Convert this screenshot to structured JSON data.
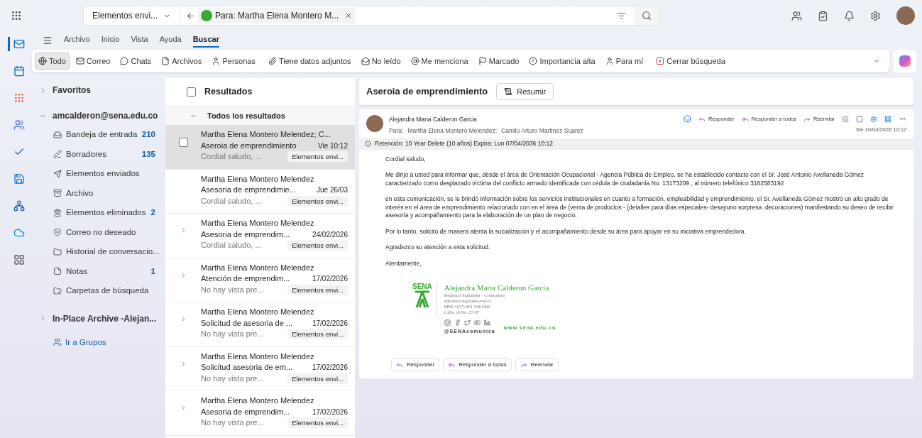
{
  "top_bar": {
    "folder_scope": "Elementos envi...",
    "search_chip": "Para: Martha Elena Montero M..."
  },
  "app_rail": [
    {
      "selected": true
    },
    {
      "selected": false
    },
    {
      "selected": false
    },
    {
      "selected": false
    },
    {
      "selected": false
    },
    {
      "selected": false
    },
    {
      "selected": false
    },
    {
      "selected": false
    },
    {
      "selected": false
    }
  ],
  "ribbon_tabs": [
    {
      "label": "Archivo",
      "selected": false
    },
    {
      "label": "Inicio",
      "selected": false
    },
    {
      "label": "Vista",
      "selected": false
    },
    {
      "label": "Ayuda",
      "selected": false
    },
    {
      "label": "Buscar",
      "selected": true
    }
  ],
  "filters": [
    {
      "label": "Todo",
      "selected": true
    },
    {
      "label": "Correo",
      "selected": false
    },
    {
      "label": "Chats",
      "selected": false
    },
    {
      "label": "Archivos",
      "selected": false
    },
    {
      "label": "Personas",
      "selected": false
    },
    {
      "label": "Tiene datos adjuntos",
      "selected": false
    },
    {
      "label": "No leído",
      "selected": false
    },
    {
      "label": "Me menciona",
      "selected": false
    },
    {
      "label": "Marcado",
      "selected": false
    },
    {
      "label": "Importancia alta",
      "selected": false
    },
    {
      "label": "Para mí",
      "selected": false
    },
    {
      "label": "Cerrar búsqueda",
      "selected": false
    }
  ],
  "folder_pane": {
    "favorites": "Favoritos",
    "account": "amcalderon@sena.edu.co",
    "folders": [
      {
        "name": "Bandeja de entrada",
        "count": "210"
      },
      {
        "name": "Borradores",
        "count": "135"
      },
      {
        "name": "Elementos enviados"
      },
      {
        "name": "Archivo"
      },
      {
        "name": "Elementos eliminados",
        "count": "2"
      },
      {
        "name": "Correo no deseado"
      },
      {
        "name": "Historial de conversacio..."
      },
      {
        "name": "Notas",
        "count": "1"
      },
      {
        "name": "Carpetas de búsqueda"
      }
    ],
    "archive": "In-Place Archive -Alejan...",
    "groups_link": "Ir a Grupos"
  },
  "message_list": {
    "title": "Resultados",
    "select_all_checked": false,
    "group": "Todos los resultados",
    "items": [
      {
        "sender": "Martha Elena Montero Melendez; C...",
        "subject": "Aseroia de emprendimiento",
        "date": "Vie 10:12",
        "preview": "Cordial saludo, ...",
        "folder": "Elementos envi...",
        "selected": true,
        "thread": false
      },
      {
        "sender": "Martha Elena Montero Melendez",
        "subject": "Asesoria de emprendimie...",
        "date": "Jue 26/03",
        "preview": "Cordial saludo, ...",
        "folder": "Elementos envi...",
        "selected": false,
        "thread": false
      },
      {
        "sender": "Martha Elena Montero Melendez",
        "subject": "Asesoria de emprendim...",
        "date": "24/02/2026",
        "preview": "Cordial saludo, ...",
        "folder": "Elementos envi...",
        "selected": false,
        "thread": true
      },
      {
        "sender": "Martha Elena Montero Melendez",
        "subject": "Atención de emprendim...",
        "date": "17/02/2026",
        "preview": "No hay vista pre...",
        "folder": "Elementos envi...",
        "selected": false,
        "thread": true
      },
      {
        "sender": "Martha Elena Montero Melendez",
        "subject": "Solicitud de asesoria de ...",
        "date": "17/02/2026",
        "preview": "No hay vista pre...",
        "folder": "Elementos envi...",
        "selected": false,
        "thread": true
      },
      {
        "sender": "Martha Elena Montero Melendez",
        "subject": "Solicitud asesoria de em...",
        "date": "17/02/2026",
        "preview": "No hay vista pre...",
        "folder": "Elementos envi...",
        "selected": false,
        "thread": true
      },
      {
        "sender": "Martha Elena Montero Melendez",
        "subject": "Asesoria de emprendim...",
        "date": "17/02/2026",
        "preview": "No hay vista pre...",
        "folder": "Elementos envi...",
        "selected": false,
        "thread": true
      }
    ]
  },
  "reading_pane": {
    "subject": "Aseroia de emprendimiento",
    "summarize": "Resumir",
    "from": "Alejandra Maria Calderon Garcia",
    "to_label": "Para:",
    "to": [
      "Martha Elena Montero Melendez;",
      "Camilo Arturo Martinez Suarez"
    ],
    "actions": [
      "Responder",
      "Responder a todos",
      "Reenviar"
    ],
    "date": "Vie 10/04/2026 10:12",
    "retention": "Retención: 10 Year Delete (10 años) Expira: Lun 07/04/2036 10:12",
    "body": [
      "Cordial saludo,",
      "Me dirijo a usted para informar que, desde el área de Orientación Ocupacional - Agencia Pública de Empleo, se ha establecido contacto con el Sr. José Antonio Avellaneda Gómez caracterizado como desplazado víctima del conflicto armado identificada con cédula de ciudadanía No. 13173209 , al número telefónico 3182583192",
      "en esta comunicación, se le brindó información sobre los servicios institucionales en cuanto a formación, empleabilidad y emprendimiento. el Sr. Avellaneda Gómez  mostró un alto grado de interés en el área de emprendimiento relacionado con en el área de (venta de productos - (detalles para días especiales- desayuno sorpresa .decoraciones)  manifestando su deseo de recibir asesoría y acompañamiento para la elaboración de un plan de negocio.",
      "Por lo tanto, solicito de manera atenta la socialización y el acompañamiento desde su área para apoyar  en su iniciativa emprendedora.",
      "Agradezco su atención a esta solicitud.",
      "Atentamente,"
    ],
    "signature": {
      "logo_text": "SENA",
      "name": "Alejandra Maria Calderon Garcia",
      "lines": [
        "Regional Santander - Contratista",
        "amcalderon@sena.edu.co",
        "PBX:+(57) 601 5461500",
        "Calle 16 No. 27-37"
      ],
      "handle": "@SENAcomunica",
      "website": "www.sena.edu.co"
    },
    "footer_actions": [
      "Responder",
      "Responder a todos",
      "Reenviar"
    ]
  }
}
